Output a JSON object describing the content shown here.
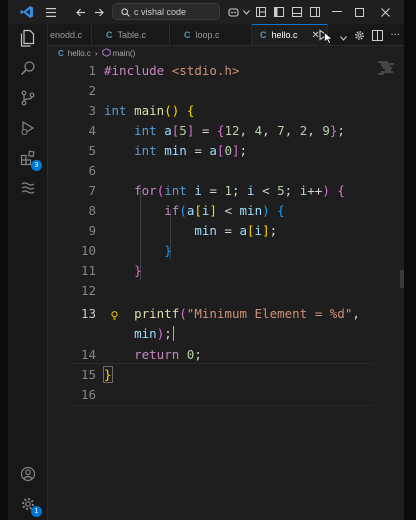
{
  "titlebar": {
    "search_text": "c vishal code"
  },
  "activity_bar": {
    "extensions_badge": "3",
    "settings_badge": "1"
  },
  "tabs": [
    {
      "label": "enodd.c",
      "active": false
    },
    {
      "label": "Table.c",
      "active": false
    },
    {
      "label": "loop.c",
      "active": false
    },
    {
      "label": "hello.c",
      "active": true
    }
  ],
  "breadcrumb": {
    "file": "hello.c",
    "symbol": "main()"
  },
  "editor": {
    "current_line": 13,
    "lines": [
      {
        "n": "1"
      },
      {
        "n": "2"
      },
      {
        "n": "3"
      },
      {
        "n": "4"
      },
      {
        "n": "5"
      },
      {
        "n": "6"
      },
      {
        "n": "7"
      },
      {
        "n": "8"
      },
      {
        "n": "9"
      },
      {
        "n": "10"
      },
      {
        "n": "11"
      },
      {
        "n": "12"
      },
      {
        "n": "13"
      },
      {
        "n": ""
      },
      {
        "n": "14"
      },
      {
        "n": "15"
      },
      {
        "n": "16"
      }
    ],
    "code": {
      "l1_directive": "#include",
      "l1_header": "<stdio.h>",
      "l3_type": "int",
      "l3_fn": "main",
      "l4_type": "int",
      "l4_rest_var": "a",
      "l4_n1": "5",
      "l4_vals": [
        "12",
        "4",
        "7",
        "2",
        "9"
      ],
      "l5_type": "int",
      "l5_var": "min",
      "l5_arr": "a",
      "l5_idx": "0",
      "l7_for": "for",
      "l7_type": "int",
      "l7_i": "i",
      "l7_one": "1",
      "l7_five": "5",
      "l8_if": "if",
      "l13_fn": "printf",
      "l13_str": "\"Minimum Element = %d\"",
      "l13b_var": "min",
      "l14_return": "return",
      "l14_zero": "0"
    }
  },
  "colors": {
    "accent": "#0078d4",
    "editor_bg": "#1e1e1e"
  }
}
